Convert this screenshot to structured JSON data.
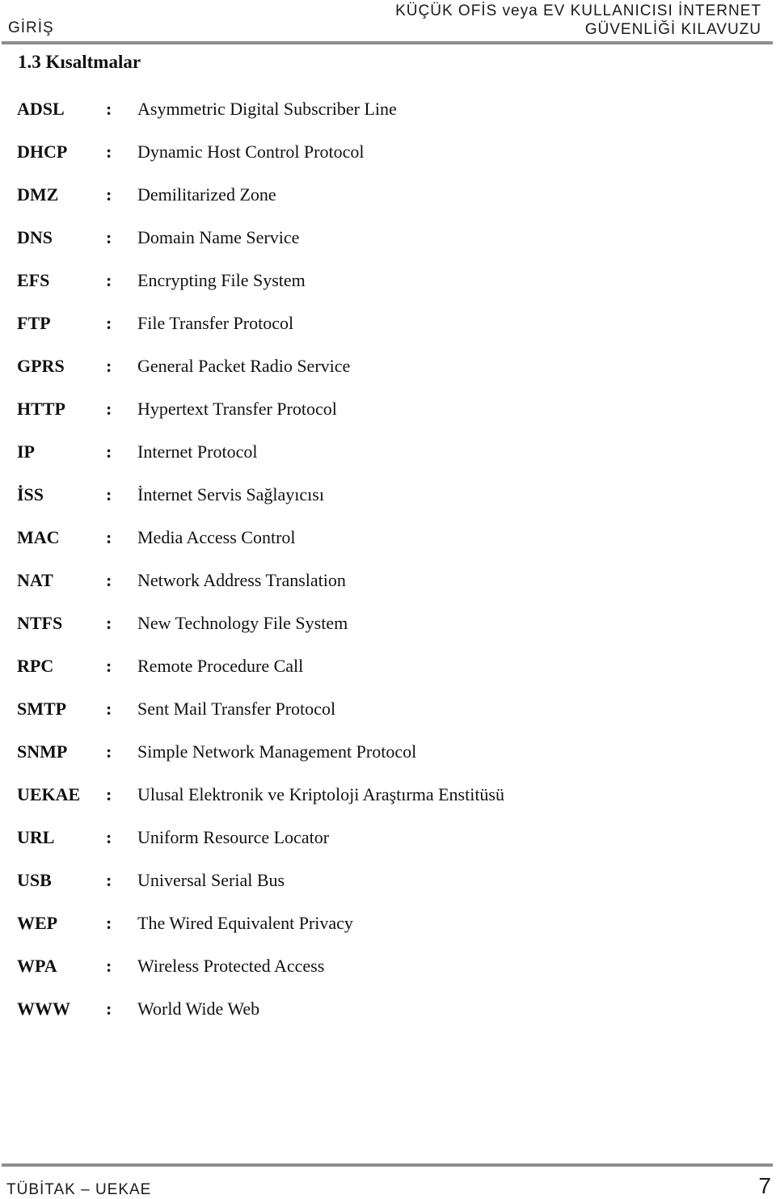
{
  "header": {
    "left": "GİRİŞ",
    "right_line1": "KÜÇÜK OFİS veya EV KULLANICISI İNTERNET",
    "right_line2": "GÜVENLİĞİ KILAVUZU"
  },
  "section_title": "1.3 Kısaltmalar",
  "abbreviations": [
    {
      "abbr": "ADSL",
      "sep": ":",
      "definition": "Asymmetric Digital Subscriber Line"
    },
    {
      "abbr": "DHCP",
      "sep": ":",
      "definition": "Dynamic Host Control Protocol"
    },
    {
      "abbr": "DMZ",
      "sep": ":",
      "definition": "Demilitarized Zone"
    },
    {
      "abbr": "DNS",
      "sep": ":",
      "definition": "Domain Name Service"
    },
    {
      "abbr": "EFS",
      "sep": ":",
      "definition": "Encrypting File System"
    },
    {
      "abbr": "FTP",
      "sep": ":",
      "definition": "File Transfer Protocol"
    },
    {
      "abbr": "GPRS",
      "sep": ":",
      "definition": "General Packet Radio Service"
    },
    {
      "abbr": "HTTP",
      "sep": ":",
      "definition": "Hypertext Transfer Protocol"
    },
    {
      "abbr": "IP",
      "sep": ":",
      "definition": "Internet Protocol"
    },
    {
      "abbr": "İSS",
      "sep": ":",
      "definition": "İnternet Servis Sağlayıcısı"
    },
    {
      "abbr": "MAC",
      "sep": ":",
      "definition": "Media Access Control"
    },
    {
      "abbr": "NAT",
      "sep": ":",
      "definition": "Network Address Translation"
    },
    {
      "abbr": "NTFS",
      "sep": ":",
      "definition": "New Technology File System"
    },
    {
      "abbr": "RPC",
      "sep": ":",
      "definition": "Remote Procedure Call"
    },
    {
      "abbr": "SMTP",
      "sep": ":",
      "definition": "Sent Mail Transfer Protocol"
    },
    {
      "abbr": "SNMP",
      "sep": ":",
      "definition": "Simple Network Management Protocol"
    },
    {
      "abbr": "UEKAE",
      "sep": ":",
      "definition": "Ulusal Elektronik ve Kriptoloji Araştırma Enstitüsü"
    },
    {
      "abbr": "URL",
      "sep": ":",
      "definition": "Uniform Resource Locator"
    },
    {
      "abbr": "USB",
      "sep": ":",
      "definition": "Universal Serial Bus"
    },
    {
      "abbr": "WEP",
      "sep": ":",
      "definition": "The Wired Equivalent Privacy"
    },
    {
      "abbr": "WPA",
      "sep": ":",
      "definition": "Wireless Protected Access"
    },
    {
      "abbr": "WWW",
      "sep": ":",
      "definition": "World Wide Web"
    }
  ],
  "footer": {
    "left": "TÜBİTAK – UEKAE",
    "page_number": "7"
  }
}
